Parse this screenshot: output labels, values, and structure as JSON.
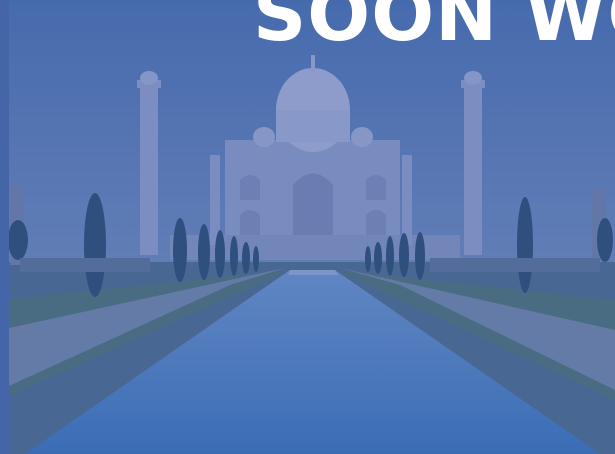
{
  "hero": {
    "headline": "SOON WO"
  },
  "colors": {
    "overlay": "#3a5f9f",
    "headline": "#ffffff"
  }
}
